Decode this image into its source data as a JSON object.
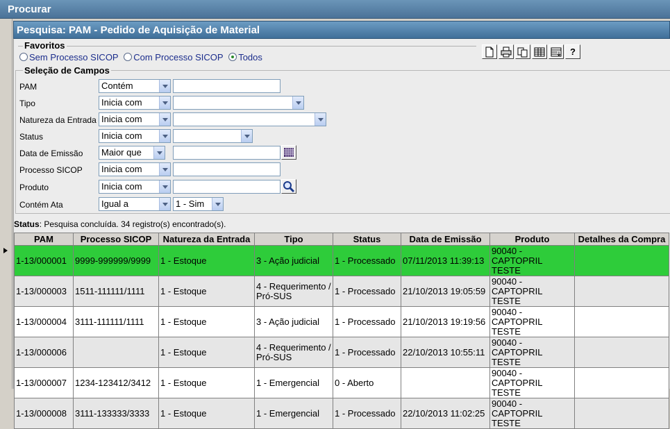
{
  "window": {
    "title": "Procurar"
  },
  "panel": {
    "title": "Pesquisa: PAM - Pedido de Aquisição de Material"
  },
  "favorites": {
    "label": "Favoritos",
    "options": [
      {
        "label": "Sem Processo SICOP",
        "checked": false
      },
      {
        "label": "Com Processo SICOP",
        "checked": false
      },
      {
        "label": "Todos",
        "checked": true
      }
    ]
  },
  "toolbar": {
    "help_label": "?"
  },
  "fields": {
    "section_title": "Seleção de Campos",
    "pam": {
      "label": "PAM",
      "operator": "Contém",
      "value": ""
    },
    "tipo": {
      "label": "Tipo",
      "operator": "Inicia com",
      "value": ""
    },
    "natureza": {
      "label": "Natureza da Entrada",
      "operator": "Inicia com",
      "value": ""
    },
    "status": {
      "label": "Status",
      "operator": "Inicia com",
      "value": ""
    },
    "data_emissao": {
      "label": "Data de Emissão",
      "operator": "Maior que",
      "value": ""
    },
    "processo": {
      "label": "Processo SICOP",
      "operator": "Inicia com",
      "value": ""
    },
    "produto": {
      "label": "Produto",
      "operator": "Inicia com",
      "value": ""
    },
    "contem_ata": {
      "label": "Contém Ata",
      "operator": "Igual a",
      "value": "1 - Sim"
    }
  },
  "status": {
    "label": "Status",
    "text": ": Pesquisa concluída. 34 registro(s) encontrado(s)."
  },
  "grid": {
    "columns": [
      "PAM",
      "Processo SICOP",
      "Natureza da Entrada",
      "Tipo",
      "Status",
      "Data de Emissão",
      "Produto",
      "Detalhes da Compra"
    ],
    "rows": [
      [
        "1-13/000001",
        "9999-999999/9999",
        "1 - Estoque",
        "3 - Ação judicial",
        "1 - Processado",
        "07/11/2013 11:39:13",
        "90040 - CAPTOPRIL TESTE",
        ""
      ],
      [
        "1-13/000003",
        "1511-111111/1111",
        "1 - Estoque",
        "4 - Requerimento / Pró-SUS",
        "1 - Processado",
        "21/10/2013 19:05:59",
        "90040 - CAPTOPRIL TESTE",
        ""
      ],
      [
        "1-13/000004",
        "3111-111111/1111",
        "1 - Estoque",
        "3 - Ação judicial",
        "1 - Processado",
        "21/10/2013 19:19:56",
        "90040 - CAPTOPRIL TESTE",
        ""
      ],
      [
        "1-13/000006",
        "",
        "1 - Estoque",
        "4 - Requerimento / Pró-SUS",
        "1 - Processado",
        "22/10/2013 10:55:11",
        "90040 - CAPTOPRIL TESTE",
        ""
      ],
      [
        "1-13/000007",
        "1234-123412/3412",
        "1 - Estoque",
        "1 - Emergencial",
        "0 - Aberto",
        "",
        "90040 - CAPTOPRIL TESTE",
        ""
      ],
      [
        "1-13/000008",
        "3111-133333/3333",
        "1 - Estoque",
        "1 - Emergencial",
        "1 - Processado",
        "22/10/2013 11:02:25",
        "90040 - CAPTOPRIL TESTE",
        ""
      ]
    ],
    "selected_row": 0
  },
  "colors": {
    "selected_row": "#2ecc3a",
    "header_blue": "#4a7298"
  }
}
